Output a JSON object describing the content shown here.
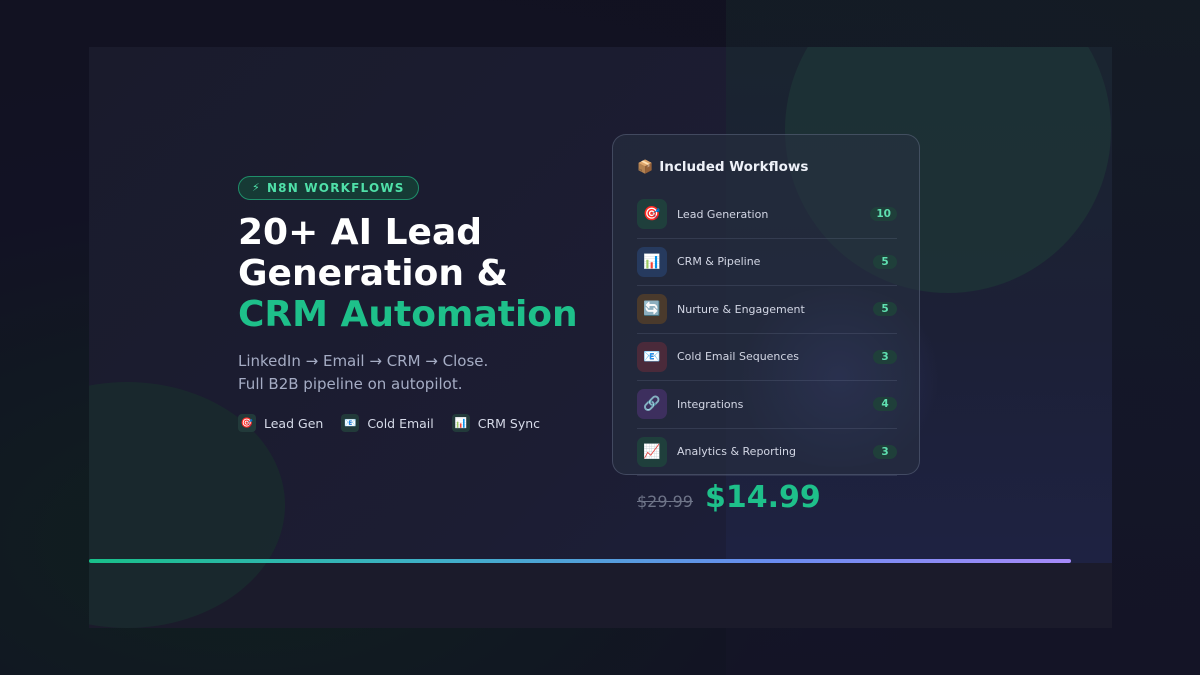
{
  "badge": {
    "icon": "lightning-icon",
    "glyph": "⚡",
    "label": "N8N WORKFLOWS"
  },
  "headline": {
    "line1": "20+ AI Lead",
    "line2": "Generation &",
    "accent": "CRM Automation"
  },
  "subtitle": {
    "line1": "LinkedIn → Email → CRM → Close.",
    "line2": "Full B2B pipeline on autopilot."
  },
  "tags": [
    {
      "icon": "target-icon",
      "glyph": "🎯",
      "label": "Lead Gen"
    },
    {
      "icon": "email-icon",
      "glyph": "📧",
      "label": "Cold Email"
    },
    {
      "icon": "chart-icon",
      "glyph": "📊",
      "label": "CRM Sync"
    }
  ],
  "card": {
    "title": "Included Workflows",
    "title_glyph": "📦",
    "rows": [
      {
        "icon": "target-icon",
        "glyph": "🎯",
        "label": "Lead Generation",
        "count": "10",
        "color": "#1f3f3c"
      },
      {
        "icon": "bar-chart-icon",
        "glyph": "📊",
        "label": "CRM & Pipeline",
        "count": "5",
        "color": "#263a5e"
      },
      {
        "icon": "refresh-icon",
        "glyph": "🔄",
        "label": "Nurture & Engagement",
        "count": "5",
        "color": "#4a3a2c"
      },
      {
        "icon": "email-icon",
        "glyph": "📧",
        "label": "Cold Email Sequences",
        "count": "3",
        "color": "#4a2a3a"
      },
      {
        "icon": "link-icon",
        "glyph": "🔗",
        "label": "Integrations",
        "count": "4",
        "color": "#3d2f5e"
      },
      {
        "icon": "trend-chart-icon",
        "glyph": "📈",
        "label": "Analytics & Reporting",
        "count": "3",
        "color": "#1f3f3c"
      }
    ]
  },
  "price": {
    "old": "$29.99",
    "new": "$14.99"
  },
  "colors": {
    "accent": "#1ec08a",
    "background": "#121222"
  }
}
